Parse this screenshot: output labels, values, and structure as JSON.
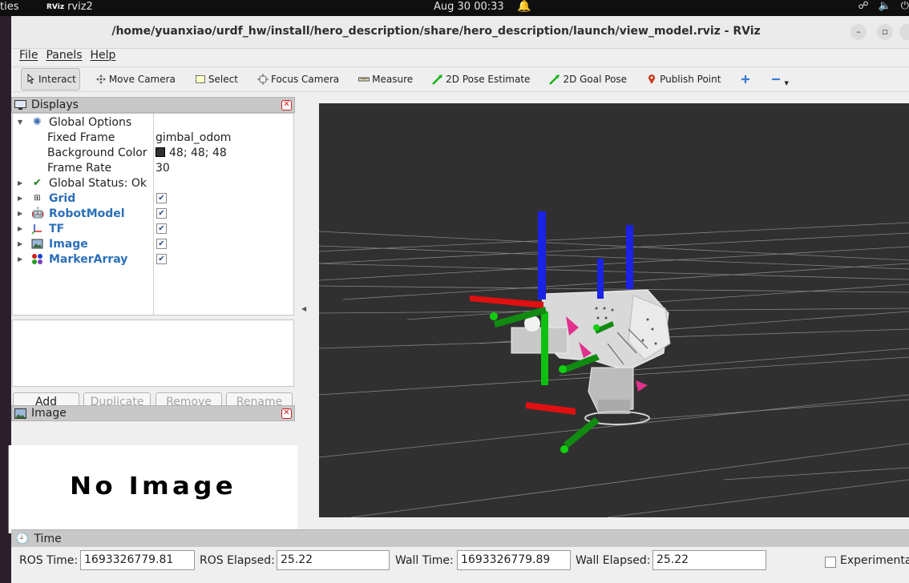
{
  "topbar": {
    "activities": "ties",
    "app_logo": "RViz",
    "app_name": "rviz2",
    "clock": "Aug 30  00:33",
    "tray_icons": [
      "network-icon",
      "volume-icon",
      "power-icon"
    ]
  },
  "window": {
    "title": "/home/yuanxiao/urdf_hw/install/hero_description/share/hero_description/launch/view_model.rviz - RViz",
    "controls": [
      "minimize",
      "maximize",
      "close"
    ]
  },
  "menu": [
    "File",
    "Panels",
    "Help"
  ],
  "toolbar": {
    "tools": [
      {
        "label": "Interact",
        "icon": "cursor-icon",
        "active": true
      },
      {
        "label": "Move Camera",
        "icon": "move-camera-icon",
        "active": false
      },
      {
        "label": "Select",
        "icon": "select-icon",
        "active": false
      },
      {
        "label": "Focus Camera",
        "icon": "focus-camera-icon",
        "active": false
      },
      {
        "label": "Measure",
        "icon": "ruler-icon",
        "active": false
      },
      {
        "label": "2D Pose Estimate",
        "icon": "pose-estimate-arrow-icon",
        "active": false
      },
      {
        "label": "2D Goal Pose",
        "icon": "goal-pose-arrow-icon",
        "active": false
      },
      {
        "label": "Publish Point",
        "icon": "map-pin-icon",
        "active": false
      }
    ]
  },
  "displays": {
    "title": "Displays",
    "global_options": {
      "label": "Global Options",
      "fixed_frame_label": "Fixed Frame",
      "fixed_frame_value": "gimbal_odom",
      "background_color_label": "Background Color",
      "background_color_value": "48; 48; 48",
      "background_color_hex": "#303030",
      "frame_rate_label": "Frame Rate",
      "frame_rate_value": "30"
    },
    "global_status": "Global Status: Ok",
    "items": [
      {
        "label": "Grid",
        "checked": true
      },
      {
        "label": "RobotModel",
        "checked": true
      },
      {
        "label": "TF",
        "checked": true
      },
      {
        "label": "Image",
        "checked": true
      },
      {
        "label": "MarkerArray",
        "checked": true
      }
    ],
    "buttons": {
      "add": "Add",
      "duplicate": "Duplicate",
      "remove": "Remove",
      "rename": "Rename"
    }
  },
  "image_panel": {
    "title": "Image",
    "placeholder": "No Image"
  },
  "time_panel": {
    "title": "Time",
    "ros_time_label": "ROS Time:",
    "ros_time_value": "1693326779.81",
    "ros_elapsed_label": "ROS Elapsed:",
    "ros_elapsed_value": "25.22",
    "wall_time_label": "Wall Time:",
    "wall_time_value": "1693326779.89",
    "wall_elapsed_label": "Wall Elapsed:",
    "wall_elapsed_value": "25.22",
    "experimental_label": "Experimenta"
  },
  "colors": {
    "background": "#303030",
    "grid": "#a0a0a0",
    "axis_x": "#e01010",
    "axis_y": "#10b010",
    "axis_z": "#1020e0",
    "accent_blue": "#2b6fb8"
  }
}
